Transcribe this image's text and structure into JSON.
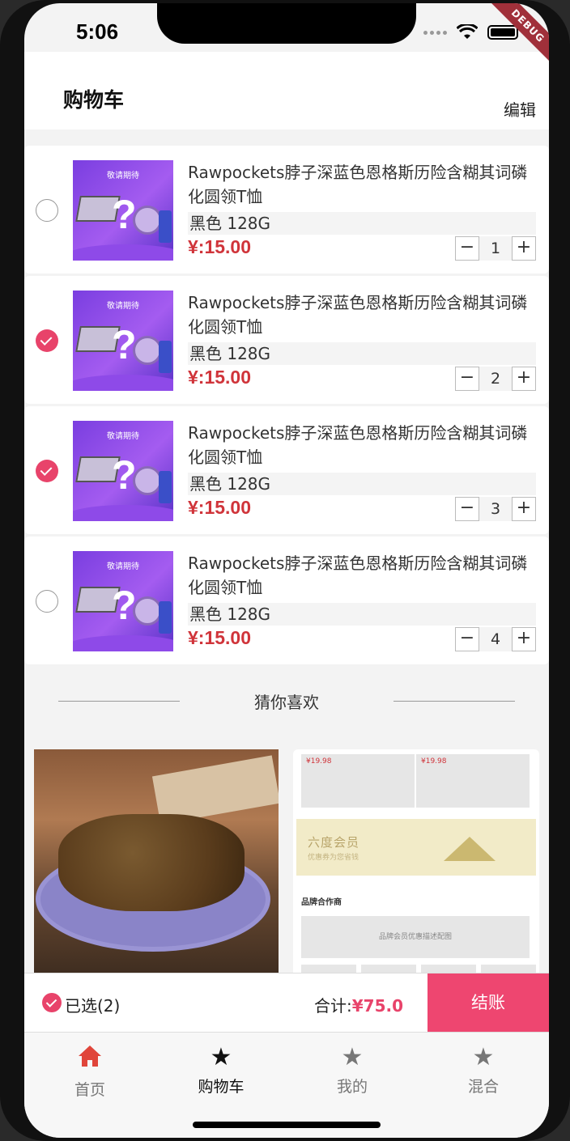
{
  "status_bar": {
    "time": "5:06",
    "debug_label": "DEBUG"
  },
  "app_bar": {
    "title": "购物车",
    "edit_label": "编辑"
  },
  "cart": {
    "items": [
      {
        "title": "Rawpockets脖子深蓝色恩格斯历险含糊其词磷化圆领T恤",
        "thumb_banner": "敬请期待",
        "spec": "黑色 128G",
        "price": "¥:15.00",
        "quantity": "1",
        "checked": false
      },
      {
        "title": "Rawpockets脖子深蓝色恩格斯历险含糊其词磷化圆领T恤",
        "thumb_banner": "敬请期待",
        "spec": "黑色 128G",
        "price": "¥:15.00",
        "quantity": "2",
        "checked": true
      },
      {
        "title": "Rawpockets脖子深蓝色恩格斯历险含糊其词磷化圆领T恤",
        "thumb_banner": "敬请期待",
        "spec": "黑色 128G",
        "price": "¥:15.00",
        "quantity": "3",
        "checked": true
      },
      {
        "title": "Rawpockets脖子深蓝色恩格斯历险含糊其词磷化圆领T恤",
        "thumb_banner": "敬请期待",
        "spec": "黑色 128G",
        "price": "¥:15.00",
        "quantity": "4",
        "checked": false
      }
    ],
    "minus_symbol": "−",
    "plus_symbol": "+",
    "thumb_symbol": "?"
  },
  "recommend": {
    "title": "猜你喜欢",
    "right_card": {
      "price_1": "¥19.98",
      "price_2": "¥19.98",
      "vip_title": "六度会员",
      "vip_subtitle": "优惠券为您省钱",
      "brand_title": "品牌合作商",
      "brand_desc": "品牌会员优惠描述配图"
    }
  },
  "checkout": {
    "selected_label": "已选(2)",
    "total_label": "合计:",
    "total_amount": "¥75.0",
    "button_label": "结账"
  },
  "tabbar": {
    "tabs": [
      {
        "label": "首页",
        "icon": "home-icon"
      },
      {
        "label": "购物车",
        "icon": "star-icon"
      },
      {
        "label": "我的",
        "icon": "star-icon"
      },
      {
        "label": "混合",
        "icon": "star-icon"
      }
    ],
    "active_index": 1
  },
  "colors": {
    "accent": "#ee4670",
    "price": "#d0343a",
    "home_icon": "#e0453a"
  }
}
